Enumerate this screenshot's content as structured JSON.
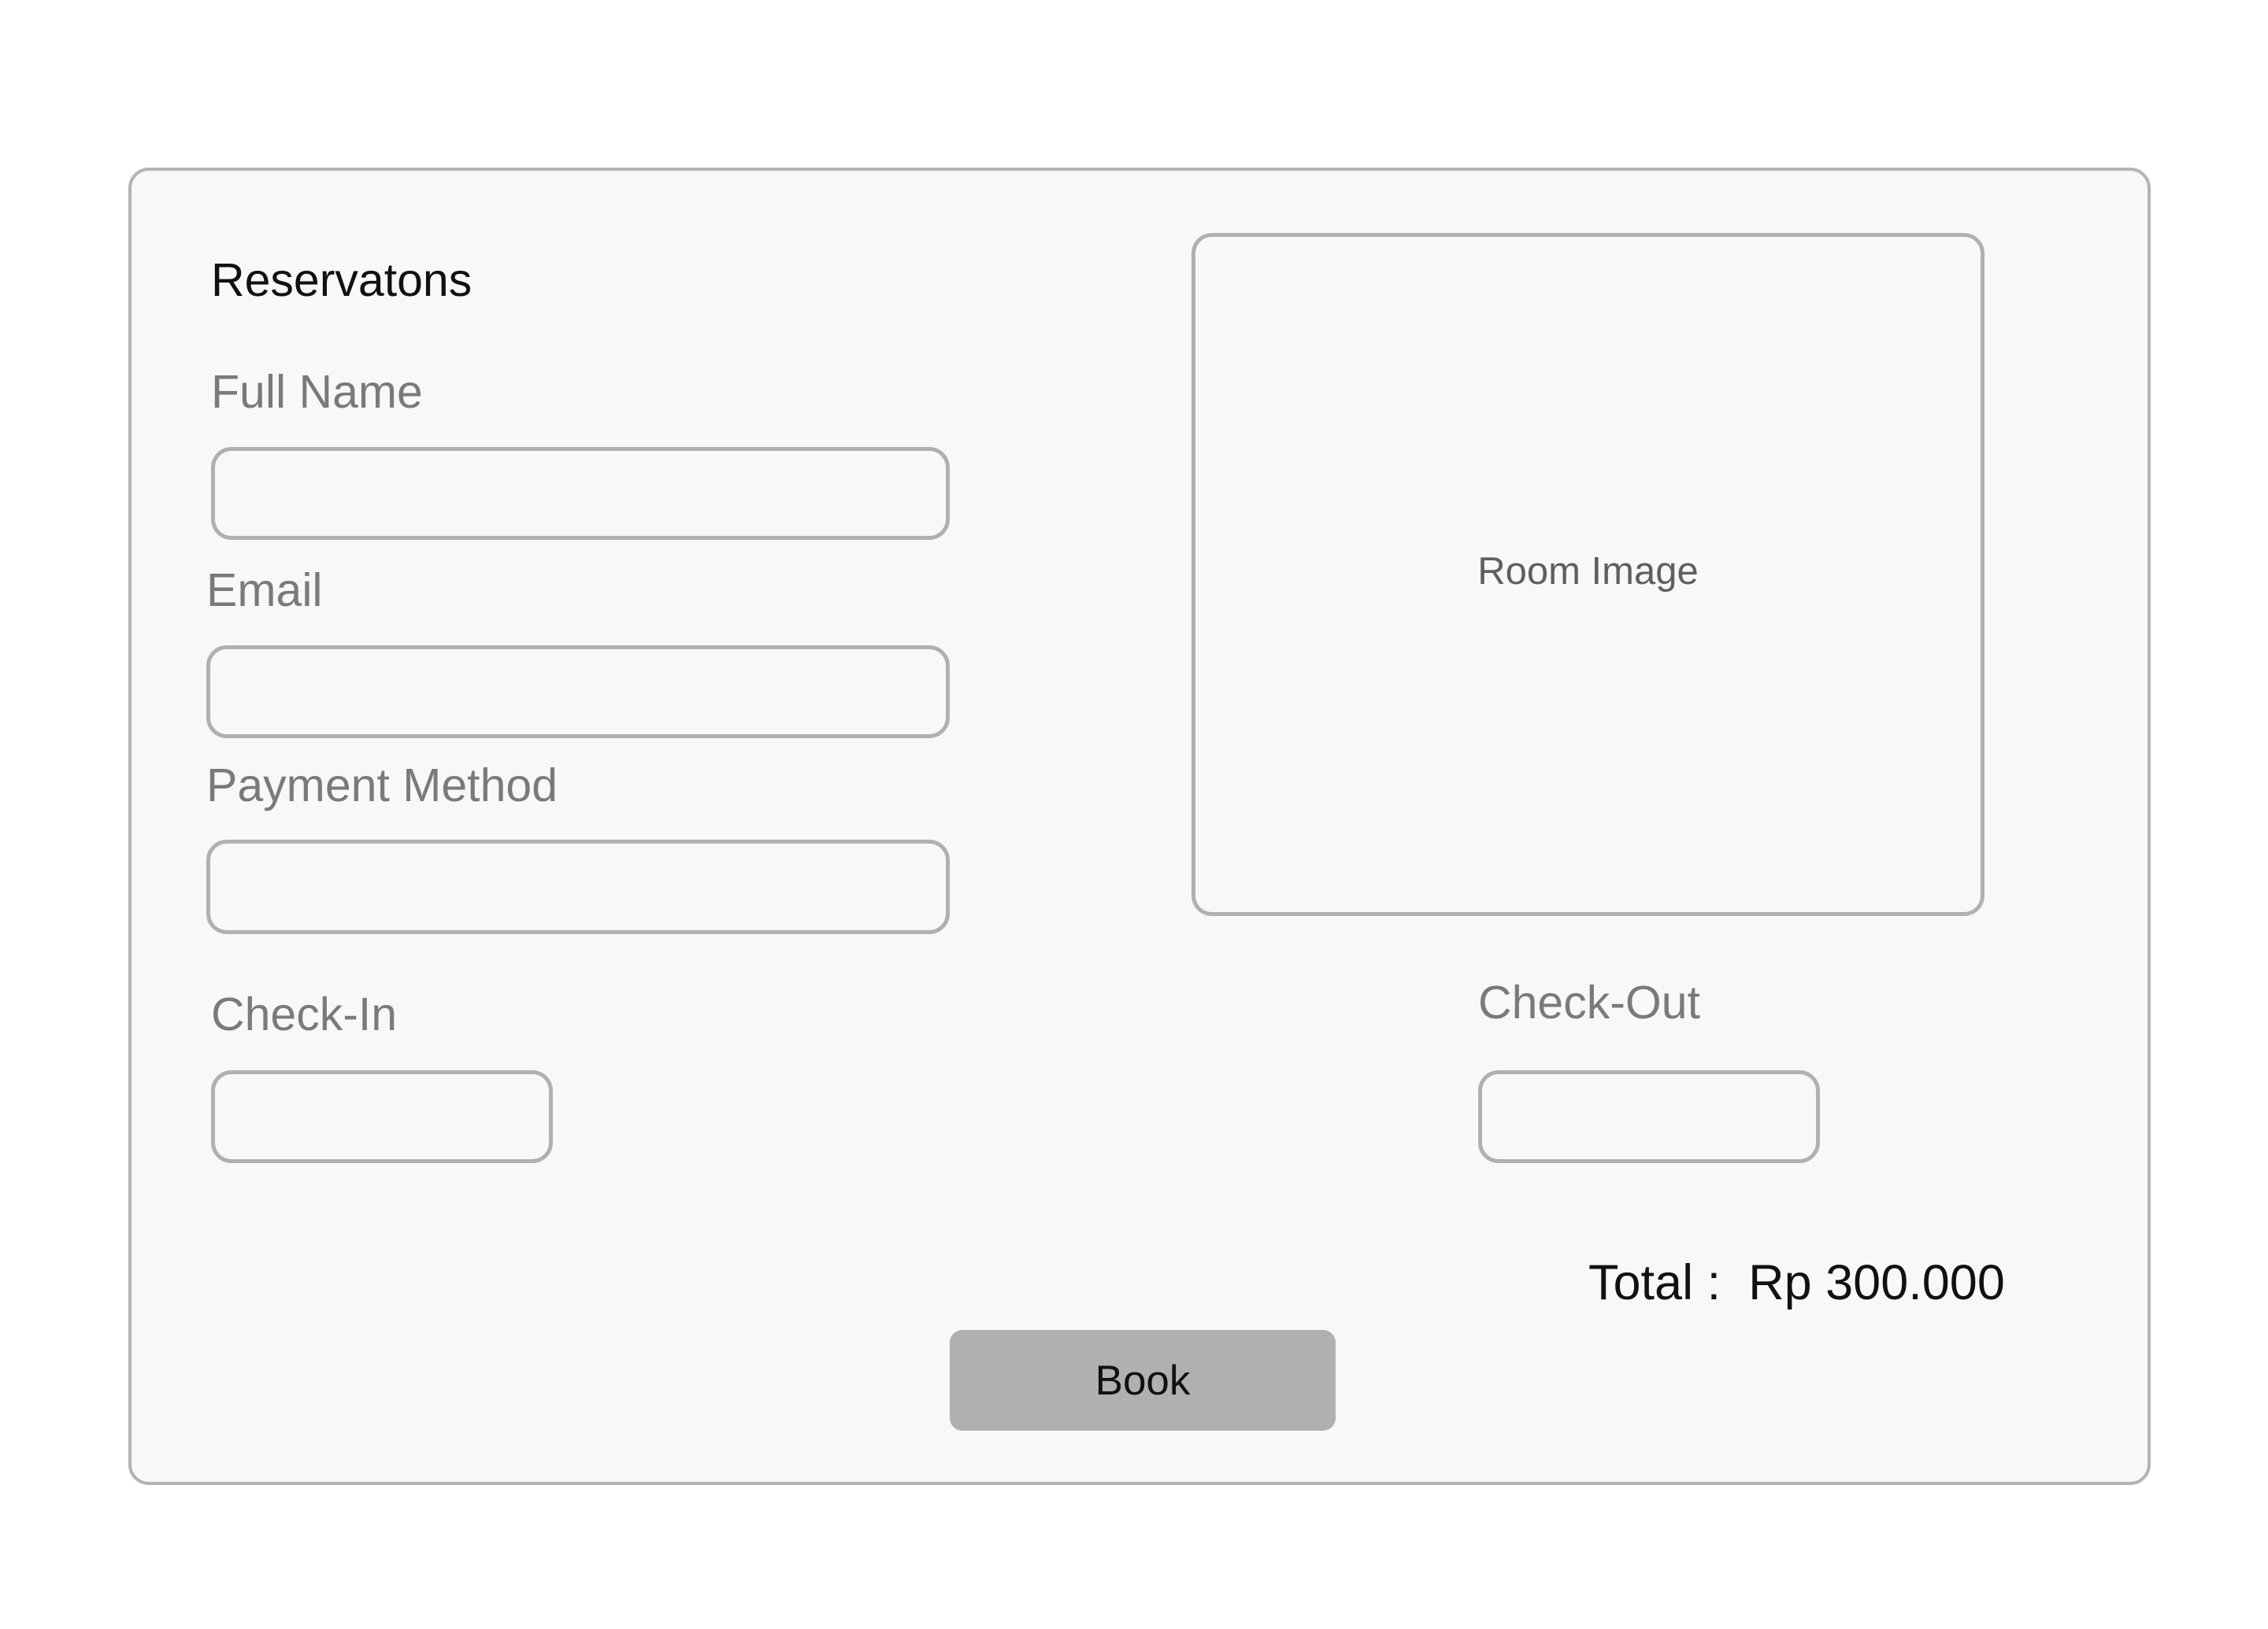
{
  "form": {
    "title": "Reservatons",
    "full_name": {
      "label": "Full Name",
      "value": "",
      "placeholder": ""
    },
    "email": {
      "label": "Email",
      "value": "",
      "placeholder": ""
    },
    "payment_method": {
      "label": "Payment Method",
      "value": "",
      "placeholder": ""
    },
    "check_in": {
      "label": "Check-In",
      "value": "",
      "placeholder": ""
    },
    "check_out": {
      "label": "Check-Out",
      "value": "",
      "placeholder": ""
    }
  },
  "room_image": {
    "label": "Room Image"
  },
  "summary": {
    "total_label": "Total :",
    "total_value": "Rp 300.000"
  },
  "actions": {
    "book_label": "Book"
  },
  "colors": {
    "card_background": "#f7f8fa",
    "border": "#b0b0b3",
    "button": "#b0b0b0",
    "label_text": "#7a7a7d"
  }
}
